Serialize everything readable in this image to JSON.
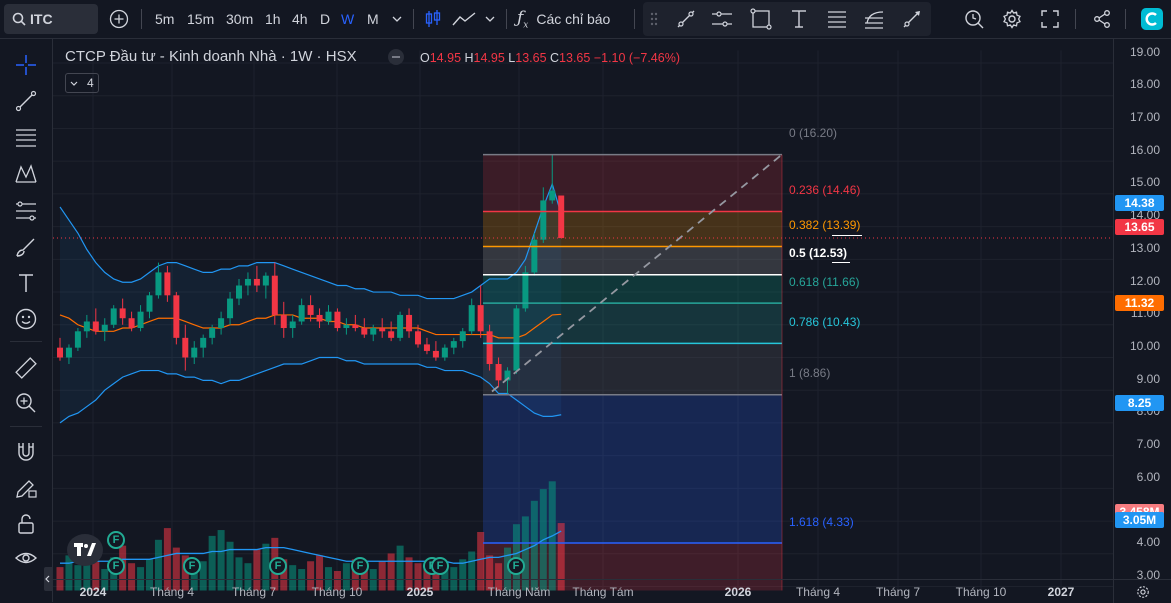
{
  "toolbar": {
    "symbol": "ITC",
    "intervals": [
      "5m",
      "15m",
      "30m",
      "1h",
      "4h",
      "D",
      "W",
      "M"
    ],
    "active_interval": "W",
    "indicators_label": "Các chỉ báo"
  },
  "legend": {
    "name": "CTCP Đầu tư - Kinh doanh Nhà",
    "interval": "1W",
    "exchange": "HSX",
    "open_label": "O",
    "open": "14.95",
    "high_label": "H",
    "high": "14.95",
    "low_label": "L",
    "low": "13.65",
    "close_label": "C",
    "close": "13.65",
    "change": "−1.10 (−7.46%)",
    "indicator_count": "4"
  },
  "colors": {
    "up": "#089981",
    "down": "#f23645",
    "accent": "#2962ff",
    "bb": "#2196f3",
    "basis": "#ff6d00"
  },
  "chart_data": {
    "type": "candlestick",
    "title": "CTCP Đầu tư - Kinh doanh Nhà · 1W · HSX",
    "xlabel": "",
    "ylabel": "",
    "ylim": [
      3,
      19.5
    ],
    "price_ticks": [
      "19.00",
      "18.00",
      "17.00",
      "16.00",
      "15.00",
      "14.00",
      "13.00",
      "12.00",
      "11.00",
      "10.00",
      "9.00",
      "8.00",
      "7.00",
      "6.00",
      "5.00",
      "4.00",
      "3.00"
    ],
    "time_ticks": [
      {
        "label": "2024",
        "bold": true
      },
      {
        "label": "Tháng 4",
        "bold": false
      },
      {
        "label": "Tháng 7",
        "bold": false
      },
      {
        "label": "Tháng 10",
        "bold": false
      },
      {
        "label": "2025",
        "bold": true
      },
      {
        "label": "Tháng Năm",
        "bold": false
      },
      {
        "label": "Tháng Tám",
        "bold": false
      },
      {
        "label": "2026",
        "bold": true
      },
      {
        "label": "Tháng 4",
        "bold": false
      },
      {
        "label": "Tháng 7",
        "bold": false
      },
      {
        "label": "Tháng 10",
        "bold": false
      },
      {
        "label": "2027",
        "bold": true
      }
    ],
    "price_labels": [
      {
        "value": 14.38,
        "text": "14.38",
        "color": "#2196f3"
      },
      {
        "value": 13.65,
        "text": "13.65",
        "color": "#f23645"
      },
      {
        "value": 11.32,
        "text": "11.32",
        "color": "#ff6d00"
      },
      {
        "value": 8.25,
        "text": "8.25",
        "color": "#2196f3"
      },
      {
        "value": 3.458,
        "text": "3.458M",
        "color": "#f77c80"
      },
      {
        "value": 3.05,
        "text": "3.05M",
        "color": "#2196f3"
      }
    ],
    "fibonacci": [
      {
        "level": "0",
        "price": 16.2,
        "text": "0 (16.20)",
        "color": "#787b86"
      },
      {
        "level": "0.236",
        "price": 14.46,
        "text": "0.236 (14.46)",
        "color": "#f23645"
      },
      {
        "level": "0.382",
        "price": 13.39,
        "text": "0.382 (13.39)",
        "color": "#ff9800"
      },
      {
        "level": "0.5",
        "price": 12.53,
        "text": "0.5 (12.53)",
        "color": "#ffffff"
      },
      {
        "level": "0.618",
        "price": 11.66,
        "text": "0.618 (11.66)",
        "color": "#26a69a"
      },
      {
        "level": "0.786",
        "price": 10.43,
        "text": "0.786 (10.43)",
        "color": "#26c6da"
      },
      {
        "level": "1",
        "price": 8.86,
        "text": "1 (8.86)",
        "color": "#787b86"
      },
      {
        "level": "1.618",
        "price": 4.33,
        "text": "1.618 (4.33)",
        "color": "#2962ff"
      }
    ],
    "candles": [
      [
        10.3,
        10.6,
        9.9,
        10.0
      ],
      [
        10.0,
        10.4,
        9.8,
        10.3
      ],
      [
        10.3,
        10.9,
        10.2,
        10.8
      ],
      [
        10.8,
        11.3,
        10.6,
        11.1
      ],
      [
        11.1,
        11.5,
        10.7,
        10.8
      ],
      [
        10.8,
        11.2,
        10.5,
        11.0
      ],
      [
        11.0,
        11.6,
        10.9,
        11.5
      ],
      [
        11.5,
        11.8,
        11.0,
        11.2
      ],
      [
        11.2,
        11.4,
        10.8,
        10.9
      ],
      [
        10.9,
        11.6,
        10.8,
        11.4
      ],
      [
        11.4,
        12.0,
        11.2,
        11.9
      ],
      [
        11.9,
        12.9,
        11.8,
        12.6
      ],
      [
        12.6,
        12.8,
        11.7,
        11.9
      ],
      [
        11.9,
        12.0,
        10.4,
        10.6
      ],
      [
        10.6,
        11.0,
        9.6,
        10.0
      ],
      [
        10.0,
        10.5,
        9.8,
        10.3
      ],
      [
        10.3,
        10.7,
        10.0,
        10.6
      ],
      [
        10.6,
        11.0,
        10.4,
        10.9
      ],
      [
        10.9,
        11.4,
        10.7,
        11.2
      ],
      [
        11.2,
        12.0,
        11.0,
        11.8
      ],
      [
        11.8,
        12.4,
        11.6,
        12.2
      ],
      [
        12.2,
        12.6,
        11.9,
        12.4
      ],
      [
        12.4,
        12.8,
        12.0,
        12.2
      ],
      [
        12.2,
        12.6,
        11.8,
        12.5
      ],
      [
        12.5,
        12.9,
        11.0,
        11.3
      ],
      [
        11.3,
        11.7,
        10.6,
        10.9
      ],
      [
        10.9,
        11.3,
        10.6,
        11.1
      ],
      [
        11.1,
        11.8,
        11.0,
        11.6
      ],
      [
        11.6,
        11.9,
        11.1,
        11.3
      ],
      [
        11.3,
        11.5,
        10.9,
        11.1
      ],
      [
        11.1,
        11.6,
        11.0,
        11.4
      ],
      [
        11.4,
        11.5,
        10.8,
        10.9
      ],
      [
        10.9,
        11.2,
        10.7,
        11.0
      ],
      [
        11.0,
        11.3,
        10.8,
        10.9
      ],
      [
        10.9,
        11.2,
        10.6,
        10.7
      ],
      [
        10.7,
        11.0,
        10.5,
        10.9
      ],
      [
        10.9,
        11.2,
        10.6,
        10.8
      ],
      [
        10.8,
        11.1,
        10.5,
        10.6
      ],
      [
        10.6,
        11.4,
        10.5,
        11.3
      ],
      [
        11.3,
        11.5,
        10.6,
        10.8
      ],
      [
        10.8,
        11.0,
        10.3,
        10.4
      ],
      [
        10.4,
        10.6,
        10.1,
        10.2
      ],
      [
        10.2,
        10.5,
        9.9,
        10.0
      ],
      [
        10.0,
        10.4,
        9.9,
        10.3
      ],
      [
        10.3,
        10.6,
        10.1,
        10.5
      ],
      [
        10.5,
        10.9,
        10.3,
        10.8
      ],
      [
        10.8,
        11.8,
        10.7,
        11.6
      ],
      [
        11.6,
        12.2,
        10.6,
        10.8
      ],
      [
        10.8,
        11.0,
        9.6,
        9.8
      ],
      [
        9.8,
        10.0,
        9.1,
        9.3
      ],
      [
        9.3,
        9.7,
        8.9,
        9.6
      ],
      [
        9.6,
        11.6,
        9.5,
        11.5
      ],
      [
        11.5,
        12.8,
        11.4,
        12.6
      ],
      [
        12.6,
        13.8,
        12.5,
        13.6
      ],
      [
        13.6,
        15.2,
        13.5,
        14.8
      ],
      [
        14.8,
        16.2,
        14.7,
        15.1
      ],
      [
        14.95,
        14.95,
        13.65,
        13.65
      ]
    ],
    "volume": [
      1.2,
      1.8,
      1.3,
      2.0,
      1.5,
      1.1,
      1.7,
      2.3,
      1.4,
      1.2,
      1.6,
      2.6,
      3.2,
      2.2,
      1.8,
      1.3,
      1.5,
      2.8,
      3.1,
      2.5,
      1.7,
      1.4,
      2.1,
      2.4,
      2.7,
      1.6,
      1.3,
      1.1,
      1.5,
      1.8,
      1.2,
      1.0,
      1.4,
      1.6,
      1.3,
      1.1,
      1.5,
      1.9,
      2.3,
      1.7,
      1.4,
      1.1,
      1.3,
      1.5,
      1.2,
      1.6,
      2.0,
      3.0,
      1.8,
      1.4,
      2.2,
      3.4,
      3.8,
      4.6,
      5.2,
      5.6,
      3.458
    ],
    "bb_upper": [
      14.6,
      14.2,
      13.8,
      13.3,
      12.9,
      12.6,
      12.4,
      12.3,
      12.3,
      12.4,
      12.6,
      12.8,
      12.9,
      12.9,
      12.8,
      12.7,
      12.6,
      12.6,
      12.7,
      12.7,
      12.8,
      12.8,
      12.9,
      12.9,
      12.9,
      12.8,
      12.7,
      12.6,
      12.5,
      12.4,
      12.3,
      12.2,
      12.2,
      12.1,
      12.1,
      12.0,
      12.0,
      12.0,
      11.9,
      11.9,
      11.9,
      11.8,
      11.8,
      11.8,
      11.8,
      11.9,
      12.0,
      12.2,
      12.4,
      12.4,
      12.4,
      12.6,
      13.0,
      13.8,
      14.6,
      15.3,
      14.38
    ],
    "bb_basis": [
      11.3,
      11.2,
      11.0,
      10.9,
      10.8,
      10.8,
      10.8,
      10.9,
      10.9,
      11.0,
      11.1,
      11.2,
      11.2,
      11.2,
      11.1,
      11.0,
      10.9,
      10.9,
      10.9,
      11.0,
      11.0,
      11.1,
      11.2,
      11.2,
      11.3,
      11.3,
      11.3,
      11.2,
      11.2,
      11.2,
      11.1,
      11.1,
      11.0,
      11.0,
      10.9,
      10.9,
      10.9,
      10.9,
      10.9,
      10.9,
      10.9,
      10.8,
      10.7,
      10.7,
      10.7,
      10.7,
      10.7,
      10.7,
      10.7,
      10.6,
      10.6,
      10.6,
      10.7,
      10.9,
      11.1,
      11.3,
      11.32
    ],
    "bb_lower": [
      8.0,
      8.2,
      8.3,
      8.5,
      8.7,
      9.0,
      9.2,
      9.4,
      9.5,
      9.6,
      9.6,
      9.6,
      9.5,
      9.5,
      9.4,
      9.4,
      9.3,
      9.3,
      9.2,
      9.3,
      9.3,
      9.4,
      9.5,
      9.6,
      9.7,
      9.8,
      9.8,
      9.8,
      9.9,
      10.0,
      10.0,
      10.0,
      9.9,
      9.9,
      9.8,
      9.8,
      9.8,
      9.8,
      9.8,
      9.8,
      9.8,
      9.7,
      9.7,
      9.6,
      9.6,
      9.6,
      9.5,
      9.4,
      9.2,
      8.9,
      8.9,
      8.7,
      8.5,
      8.3,
      8.2,
      8.2,
      8.25
    ],
    "vol_ma": [
      1.4,
      1.4,
      1.5,
      1.5,
      1.5,
      1.5,
      1.5,
      1.6,
      1.6,
      1.6,
      1.6,
      1.7,
      1.8,
      1.9,
      1.9,
      1.9,
      1.9,
      2.0,
      2.0,
      2.1,
      2.1,
      2.1,
      2.1,
      2.2,
      2.2,
      2.2,
      2.1,
      2.0,
      1.9,
      1.8,
      1.7,
      1.6,
      1.5,
      1.5,
      1.5,
      1.5,
      1.5,
      1.5,
      1.5,
      1.5,
      1.5,
      1.5,
      1.5,
      1.5,
      1.4,
      1.4,
      1.5,
      1.6,
      1.7,
      1.7,
      1.8,
      1.9,
      2.1,
      2.3,
      2.6,
      2.8,
      3.05
    ]
  }
}
